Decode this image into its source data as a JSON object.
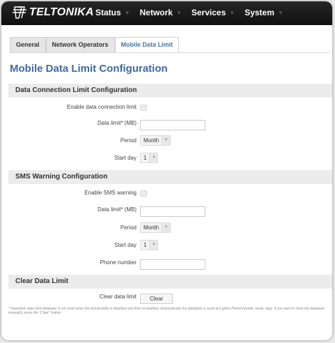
{
  "brand": {
    "name": "TELTONIKA"
  },
  "nav": [
    {
      "label": "Status"
    },
    {
      "label": "Network"
    },
    {
      "label": "Services"
    },
    {
      "label": "System"
    }
  ],
  "tabs": [
    {
      "label": "General",
      "active": false
    },
    {
      "label": "Network Operators",
      "active": false
    },
    {
      "label": "Mobile Data Limit",
      "active": true
    }
  ],
  "page_title": "Mobile Data Limit Configuration",
  "data_connection": {
    "heading": "Data Connection Limit Configuration",
    "enable_label": "Enable data connection limit",
    "enable_checked": false,
    "limit_label": "Data limit* (MB)",
    "limit_value": "",
    "period_label": "Period",
    "period_value": "Month",
    "start_label": "Start day",
    "start_value": "1"
  },
  "sms_warning": {
    "heading": "SMS Warning Configuration",
    "enable_label": "Enable SMS warning",
    "enable_checked": false,
    "limit_label": "Data limit* (MB)",
    "limit_value": "",
    "period_label": "Period",
    "period_value": "Month",
    "start_label": "Start day",
    "start_value": "1",
    "phone_label": "Phone number",
    "phone_value": ""
  },
  "clear": {
    "heading": "Clear Data Limit",
    "label": "Clear data limit",
    "button": "Clear"
  },
  "footnote": "* Important: data limit database is not reset when the functionality is disabled and then re-enabled. Automatically the database is reset at a given Period (month, week, day). If you want to reset the database manually, press the \"Clear\" button.",
  "colors": {
    "accent": "#3f6aa0",
    "topbar": "#1b1b1b",
    "section_bg": "#ececec"
  }
}
